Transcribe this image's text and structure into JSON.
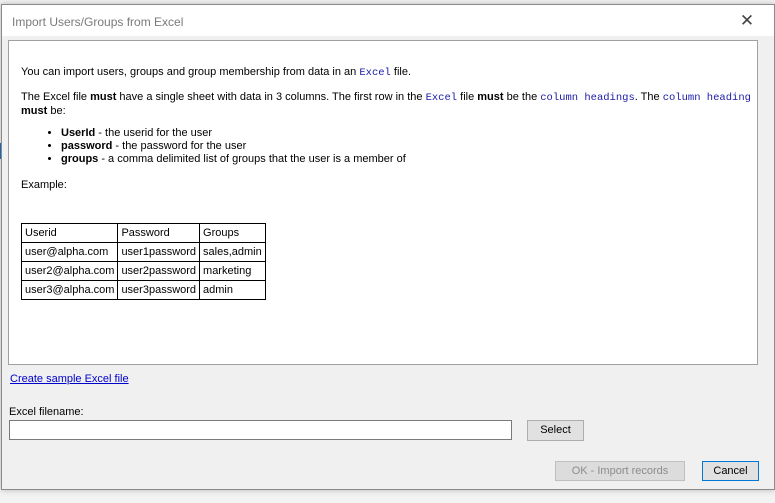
{
  "dialog": {
    "title": "Import Users/Groups from Excel",
    "close_glyph": "✕"
  },
  "info": {
    "intro_prefix": "You can import users, groups and group membership from data in an ",
    "intro_code": "Excel",
    "intro_suffix": " file.",
    "req_text1": "The Excel file ",
    "req_must1": "must",
    "req_text2": " have a single sheet with data in 3 columns. The first row in the ",
    "req_code1": "Excel",
    "req_text3": " file ",
    "req_must2": "must",
    "req_text4": " be the ",
    "req_code2": "column headings",
    "req_text5": ". The ",
    "req_code3": "column heading",
    "req_must3": "must",
    "req_text6": " be:",
    "fields": [
      {
        "name": "UserId",
        "desc": " - the userid for the user"
      },
      {
        "name": "password",
        "desc": " - the password for the user"
      },
      {
        "name": "groups",
        "desc": " - a comma delimited list of groups that the user is a member of"
      }
    ],
    "example_label": "Example:",
    "table": {
      "headers": [
        "Userid",
        "Password",
        "Groups"
      ],
      "rows": [
        [
          "user@alpha.com",
          "user1password",
          "sales,admin"
        ],
        [
          "user2@alpha.com",
          "user2password",
          "marketing"
        ],
        [
          "user3@alpha.com",
          "user3password",
          "admin"
        ]
      ]
    }
  },
  "create_sample_link": "Create sample Excel file",
  "filename": {
    "label": "Excel filename:",
    "value": ""
  },
  "buttons": {
    "select": "Select",
    "ok": "OK - Import records",
    "cancel": "Cancel"
  },
  "background": {
    "cel_fragment": "cel"
  }
}
